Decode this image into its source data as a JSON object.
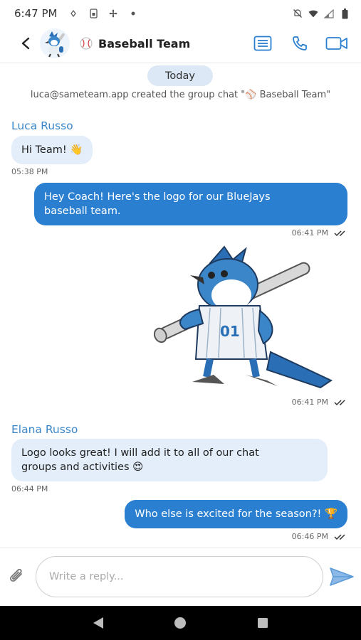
{
  "status_bar": {
    "time": "6:47 PM",
    "icons": [
      "location-icon",
      "sim-icon",
      "fan-icon",
      "dot-icon",
      "mute-icon",
      "wifi-icon",
      "signal-icon",
      "battery-icon"
    ]
  },
  "header": {
    "title": "Baseball Team",
    "title_emoji_icon": "baseball-icon",
    "actions": [
      "details-icon",
      "phone-icon",
      "video-icon"
    ]
  },
  "chat": {
    "date_label": "Today",
    "system_message": "luca@sameteam.app created the group chat \"⚾ Baseball Team\"",
    "messages": [
      {
        "sender": "Luca Russo",
        "text": "Hi Team! 👋",
        "time": "05:38 PM",
        "direction": "incoming"
      },
      {
        "text_line1": "Hey Coach! Here's the logo for our BlueJays",
        "text_line2": "baseball team.",
        "time": "06:41 PM",
        "direction": "outgoing",
        "read": true
      },
      {
        "type": "sticker",
        "sticker_text": "01",
        "time": "06:41 PM",
        "direction": "outgoing",
        "read": true
      },
      {
        "sender": "Elana Russo",
        "text_line1": "Logo looks great! I will add it to all of our chat",
        "text_line2": "groups and activities 😍",
        "time": "06:44 PM",
        "direction": "incoming"
      },
      {
        "text": "Who else is excited for the season?! 🏆",
        "time": "06:46 PM",
        "direction": "outgoing",
        "read": true
      }
    ]
  },
  "composer": {
    "placeholder": "Write a reply..."
  },
  "colors": {
    "accent": "#2b7fd0",
    "incoming_bubble": "#e3eefa",
    "sender_name": "#3a86c8",
    "date_pill": "#dce8f5"
  }
}
